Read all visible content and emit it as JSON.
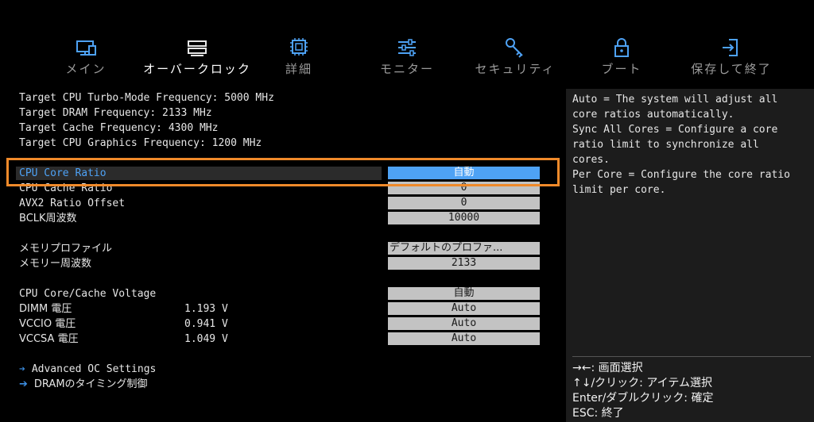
{
  "nav": {
    "tabs": [
      {
        "label": "メイン",
        "icon": "monitor-icon"
      },
      {
        "label": "オーバークロック",
        "icon": "overclock-icon",
        "active": true
      },
      {
        "label": "詳細",
        "icon": "chip-icon"
      },
      {
        "label": "モニター",
        "icon": "sliders-icon"
      },
      {
        "label": "セキュリティ",
        "icon": "key-icon"
      },
      {
        "label": "ブート",
        "icon": "lock-icon"
      },
      {
        "label": "保存して終了",
        "icon": "exit-icon"
      }
    ]
  },
  "targets": [
    "Target CPU Turbo-Mode Frequency: 5000 MHz",
    "Target DRAM Frequency: 2133 MHz",
    "Target Cache Frequency: 4300 MHz",
    "Target CPU Graphics Frequency: 1200 MHz"
  ],
  "settings": [
    {
      "label": "CPU Core Ratio",
      "value": "自動",
      "selected": true
    },
    {
      "label": "CPU Cache Ratio",
      "value": "0"
    },
    {
      "label": "AVX2 Ratio Offset",
      "value": "0"
    },
    {
      "label": "BCLK周波数",
      "value": "10000"
    },
    {
      "label": "メモリプロファイル",
      "value": "デフォルトのプロファ..."
    },
    {
      "label": "メモリー周波数",
      "value": "2133"
    },
    {
      "label": "CPU Core/Cache Voltage",
      "value": "自動"
    },
    {
      "label": "DIMM 電圧",
      "reading": "1.193 V",
      "value": "Auto"
    },
    {
      "label": "VCCIO 電圧",
      "reading": "0.941 V",
      "value": "Auto"
    },
    {
      "label": "VCCSA 電圧",
      "reading": "1.049 V",
      "value": "Auto"
    }
  ],
  "links": [
    {
      "label": "Advanced OC Settings"
    },
    {
      "label": "DRAMのタイミング制御"
    }
  ],
  "help": {
    "text": "Auto = The system will adjust all\ncore ratios automatically.\nSync All Cores = Configure a core\nratio limit to synchronize all\ncores.\nPer Core = Configure the core ratio\nlimit per core.",
    "keys": [
      "→←: 画面選択",
      "↑↓/クリック: アイテム選択",
      "Enter/ダブルクリック: 確定",
      "ESC: 終了"
    ]
  },
  "colors": {
    "accent": "#4ea2f5",
    "highlight": "#f08a2a",
    "link_arrow": "#3d8fe3"
  }
}
